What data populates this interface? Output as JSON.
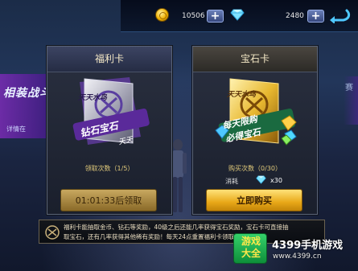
{
  "background": {
    "banner_text": "相装战斗",
    "banner_sub": "详情在",
    "right_text": "赛"
  },
  "topbar": {
    "coins": "10506",
    "gems": "2480",
    "coin_icon": "gold-coin-icon",
    "gem_icon": "diamond-icon",
    "add_label": "+",
    "back_icon": "back-arrow-icon"
  },
  "welfare_card": {
    "title": "福利卡",
    "art_line1": "天天水鸟",
    "art_line2": "钻石宝石",
    "art_line3": "天天",
    "count_text": "领取次数（1/5）",
    "button_label": "01:01:33后领取"
  },
  "gem_card": {
    "title": "宝石卡",
    "art_line1": "天天水鸟",
    "art_line2": "每天限购",
    "art_line3": "必得宝石",
    "count_text": "购买次数（0/30）",
    "cost_label": "消耗",
    "cost_value": "x30",
    "button_label": "立即购买"
  },
  "info": {
    "line1": "福利卡能抽取金币、钻石等奖励，40级之后还能几率获得宝石奖励，宝石卡可直接抽",
    "line2": "取宝石，还有几率获得其他稀有奖励！每天24点重置福利卡领取时间"
  },
  "watermark": {
    "badge": "游戏大全",
    "title": "4399手机游戏",
    "url": "www.4399.cn"
  },
  "colors": {
    "accent_gold": "#e8a818",
    "panel_border": "#5a6478",
    "count_text": "#e0c97a"
  }
}
